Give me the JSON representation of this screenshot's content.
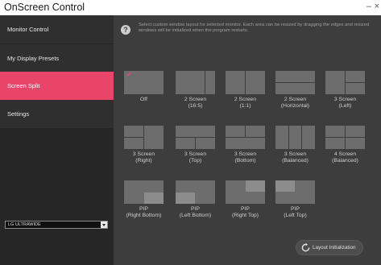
{
  "window": {
    "title": "OnScreen Control",
    "minimize_glyph": "–",
    "close_glyph": "×"
  },
  "sidebar": {
    "items": [
      {
        "label": "Monitor Control"
      },
      {
        "label": "My Display Presets"
      },
      {
        "label": "Screen Split",
        "active": true
      },
      {
        "label": "Settings"
      }
    ],
    "monitor_select": {
      "value": "LG ULTRAWIDE"
    }
  },
  "main": {
    "info_icon": "help-icon",
    "info_text": "Select custom window layout for selected monitor. Each area can be resized by dragging the edges and resized windows will be initialized when the program restarts.",
    "layouts": [
      {
        "id": "off",
        "line1": "Off",
        "line2": "",
        "selected": true
      },
      {
        "id": "2-screen-16-5",
        "line1": "2 Screen",
        "line2": "(16:5)"
      },
      {
        "id": "2-screen-1-1",
        "line1": "2 Screen",
        "line2": "(1:1)"
      },
      {
        "id": "2-screen-horizontal",
        "line1": "2 Screen",
        "line2": "(Horizontal)"
      },
      {
        "id": "3-screen-left",
        "line1": "3 Screen",
        "line2": "(Left)"
      },
      {
        "id": "3-screen-right",
        "line1": "3 Screen",
        "line2": "(Right)"
      },
      {
        "id": "3-screen-top",
        "line1": "3 Screen",
        "line2": "(Top)"
      },
      {
        "id": "3-screen-bottom",
        "line1": "3 Screen",
        "line2": "(Bottom)"
      },
      {
        "id": "3-screen-balanced",
        "line1": "3 Screen",
        "line2": "(Balanced)"
      },
      {
        "id": "4-screen-balanced",
        "line1": "4 Screen",
        "line2": "(Balanced)"
      },
      {
        "id": "pip-right-bottom",
        "line1": "PIP",
        "line2": "(Right Bottom)"
      },
      {
        "id": "pip-left-bottom",
        "line1": "PIP",
        "line2": "(Left Bottom)"
      },
      {
        "id": "pip-right-top",
        "line1": "PIP",
        "line2": "(Right Top)"
      },
      {
        "id": "pip-left-top",
        "line1": "PIP",
        "line2": "(Left Top)"
      }
    ],
    "reset_button": {
      "label": "Layout Initialization",
      "icon": "reset-icon"
    }
  },
  "colors": {
    "accent": "#e9456a",
    "sidebar_bg": "#262626",
    "main_bg": "#3d3d3d",
    "pane": "#6d6d6d",
    "pip": "#8c8c8c"
  }
}
